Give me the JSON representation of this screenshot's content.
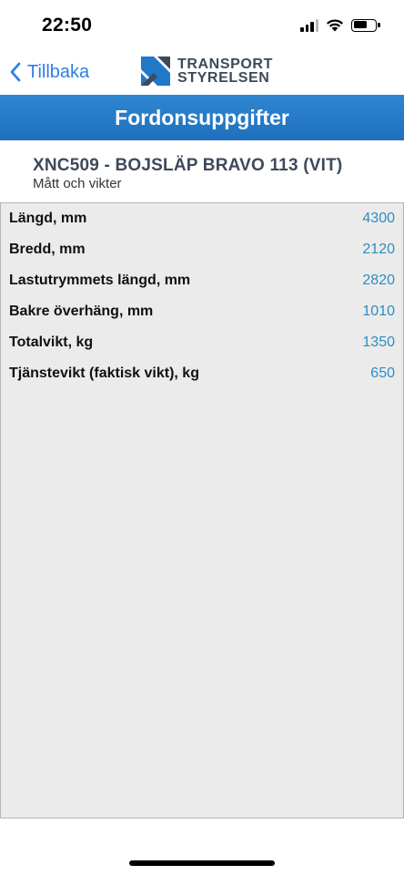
{
  "status_bar": {
    "time": "22:50",
    "icons": [
      "signal-icon",
      "wifi-icon",
      "battery-icon"
    ]
  },
  "nav": {
    "back_label": "Tillbaka",
    "logo_line1": "TRANSPORT",
    "logo_line2": "STYRELSEN"
  },
  "title": "Fordonsuppgifter",
  "vehicle": {
    "title": "XNC509 - BOJSLÄP BRAVO 113 (VIT)",
    "subtitle": "Mått och vikter"
  },
  "rows": [
    {
      "label": "Längd, mm",
      "value": "4300"
    },
    {
      "label": "Bredd, mm",
      "value": "2120"
    },
    {
      "label": "Lastutrymmets längd, mm",
      "value": "2820"
    },
    {
      "label": "Bakre överhäng, mm",
      "value": "1010"
    },
    {
      "label": "Totalvikt, kg",
      "value": "1350"
    },
    {
      "label": "Tjänstevikt (faktisk vikt), kg",
      "value": "650"
    }
  ],
  "colors": {
    "accent_blue": "#2b7fe6",
    "title_bar": "#2679c8",
    "value_blue": "#2b8fc4",
    "panel_bg": "#ebebeb",
    "logo_text": "#3d4a5c"
  }
}
